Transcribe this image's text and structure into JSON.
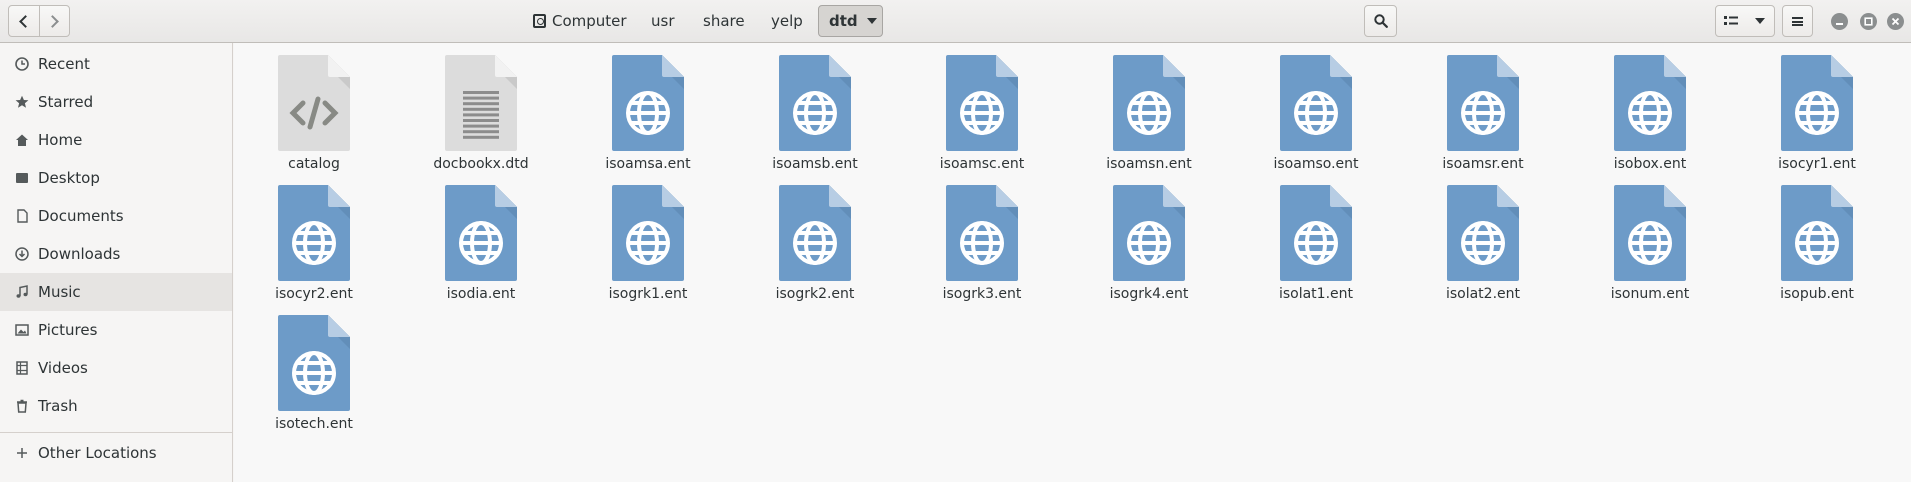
{
  "toolbar": {
    "back_icon": "chevron-left-icon",
    "forward_icon": "chevron-right-icon",
    "search_icon": "search-icon",
    "view_icon": "list-view-icon",
    "menu_icon": "hamburger-menu-icon"
  },
  "breadcrumb": {
    "items": [
      "Computer",
      "usr",
      "share",
      "yelp"
    ],
    "current": "dtd"
  },
  "window_controls": [
    "minimize-icon",
    "maximize-icon",
    "close-icon"
  ],
  "sidebar": {
    "items": [
      {
        "label": "Recent",
        "icon": "clock-icon"
      },
      {
        "label": "Starred",
        "icon": "star-icon"
      },
      {
        "label": "Home",
        "icon": "home-icon"
      },
      {
        "label": "Desktop",
        "icon": "desktop-icon"
      },
      {
        "label": "Documents",
        "icon": "document-icon"
      },
      {
        "label": "Downloads",
        "icon": "download-icon"
      },
      {
        "label": "Music",
        "icon": "music-icon"
      },
      {
        "label": "Pictures",
        "icon": "picture-icon"
      },
      {
        "label": "Videos",
        "icon": "video-icon"
      },
      {
        "label": "Trash",
        "icon": "trash-icon"
      }
    ],
    "selected": "Music",
    "other_locations": "Other Locations"
  },
  "files": [
    {
      "name": "catalog",
      "type": "code"
    },
    {
      "name": "docbookx.dtd",
      "type": "text"
    },
    {
      "name": "isoamsa.ent",
      "type": "web"
    },
    {
      "name": "isoamsb.ent",
      "type": "web"
    },
    {
      "name": "isoamsc.ent",
      "type": "web"
    },
    {
      "name": "isoamsn.ent",
      "type": "web"
    },
    {
      "name": "isoamso.ent",
      "type": "web"
    },
    {
      "name": "isoamsr.ent",
      "type": "web"
    },
    {
      "name": "isobox.ent",
      "type": "web"
    },
    {
      "name": "isocyr1.ent",
      "type": "web"
    },
    {
      "name": "isocyr2.ent",
      "type": "web"
    },
    {
      "name": "isodia.ent",
      "type": "web"
    },
    {
      "name": "isogrk1.ent",
      "type": "web"
    },
    {
      "name": "isogrk2.ent",
      "type": "web"
    },
    {
      "name": "isogrk3.ent",
      "type": "web"
    },
    {
      "name": "isogrk4.ent",
      "type": "web"
    },
    {
      "name": "isolat1.ent",
      "type": "web"
    },
    {
      "name": "isolat2.ent",
      "type": "web"
    },
    {
      "name": "isonum.ent",
      "type": "web"
    },
    {
      "name": "isopub.ent",
      "type": "web"
    },
    {
      "name": "isotech.ent",
      "type": "web"
    }
  ],
  "colors": {
    "web_file": "#6d9bc8",
    "web_file_fold": "#b7cde4",
    "generic_file": "#dcdcdc",
    "accent": "#2e3436"
  }
}
